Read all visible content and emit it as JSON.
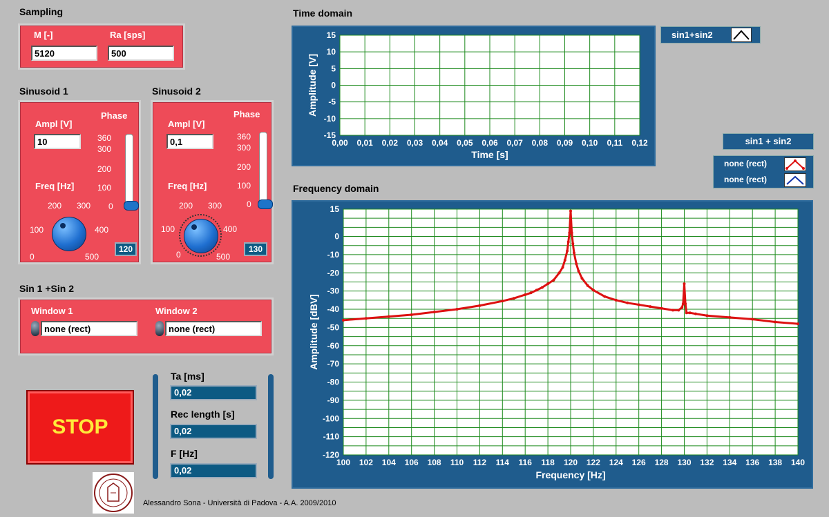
{
  "sampling": {
    "title": "Sampling",
    "m_label": "M  [-]",
    "m_value": "5120",
    "ra_label": "Ra   [sps]",
    "ra_value": "500"
  },
  "sinusoid1": {
    "title": "Sinusoid 1",
    "ampl_label": "Ampl [V]",
    "ampl_value": "10",
    "phase_label": "Phase",
    "phase_ticks": [
      "360",
      "300",
      "200",
      "100",
      "0"
    ],
    "freq_label": "Freq [Hz]",
    "knob_ticks": [
      "0",
      "100",
      "200",
      "300",
      "400",
      "500"
    ],
    "freq_value": "120"
  },
  "sinusoid2": {
    "title": "Sinusoid 2",
    "ampl_label": "Ampl [V]",
    "ampl_value": "0,1",
    "phase_label": "Phase",
    "phase_ticks": [
      "360",
      "300",
      "200",
      "100",
      "0"
    ],
    "freq_label": "Freq [Hz]",
    "knob_ticks": [
      "0",
      "100",
      "200",
      "300",
      "400",
      "500"
    ],
    "freq_value": "130"
  },
  "sum": {
    "title": "Sin 1 +Sin 2",
    "window1_label": "Window 1",
    "window1_value": "none (rect)",
    "window2_label": "Window 2",
    "window2_value": "none (rect)"
  },
  "stop_label": "STOP",
  "indicators": {
    "ta_label": "Ta   [ms]",
    "ta_value": "0,02",
    "rec_label": "Rec length  [s]",
    "rec_value": "0,02",
    "f_label": "F [Hz]",
    "f_value": "0,02"
  },
  "footer": "Alessandro Sona - Università di Padova - A.A. 2009/2010",
  "time_graph": {
    "title": "Time domain",
    "legend": "sin1+sin2"
  },
  "freq_graph": {
    "title": "Frequency domain",
    "legend_title": "sin1 + sin2",
    "legend_items": [
      "none (rect)",
      "none (rect)"
    ]
  },
  "colors": {
    "panel": "#ee4b58",
    "graph_frame": "#1f5c8d",
    "trace": "#dd1111",
    "grid": "#1c8a1c"
  },
  "chart_data": [
    {
      "type": "line",
      "title": "Time domain",
      "xlabel": "Time      [s]",
      "ylabel": "Amplitude     [V]",
      "xlim": [
        0,
        0.12
      ],
      "ylim": [
        -15,
        15
      ],
      "x_ticks": [
        "0,00",
        "0,01",
        "0,02",
        "0,03",
        "0,04",
        "0,05",
        "0,06",
        "0,07",
        "0,08",
        "0,09",
        "0,10",
        "0,11",
        "0,12"
      ],
      "y_ticks": [
        "15",
        "10",
        "5",
        "0",
        "-5",
        "-10",
        "-15"
      ],
      "grid": true,
      "series": []
    },
    {
      "type": "line",
      "title": "Frequency domain",
      "xlabel": "Frequency        [Hz]",
      "ylabel": "Amplitude     [dBV]",
      "xlim": [
        100,
        140
      ],
      "ylim": [
        -120,
        15
      ],
      "x_ticks": [
        "100",
        "102",
        "104",
        "106",
        "108",
        "110",
        "112",
        "114",
        "116",
        "118",
        "120",
        "122",
        "124",
        "126",
        "128",
        "130",
        "132",
        "134",
        "136",
        "138",
        "140"
      ],
      "y_ticks": [
        "15",
        "0",
        "-10",
        "-20",
        "-30",
        "-40",
        "-50",
        "-60",
        "-70",
        "-80",
        "-90",
        "-100",
        "-110",
        "-120"
      ],
      "grid": true,
      "series": [
        {
          "x": [
            100,
            102,
            104,
            106,
            108,
            110,
            112,
            114,
            115,
            116,
            116.5,
            117,
            117.5,
            118,
            118.5,
            119,
            119.3,
            119.5,
            119.7,
            119.8,
            119.9,
            120,
            120.1,
            120.2,
            120.3,
            120.5,
            120.7,
            121,
            121.5,
            122,
            123,
            124,
            125,
            126,
            127,
            128,
            129,
            129.5,
            129.8,
            129.9,
            130,
            130.1,
            130.2,
            130.5,
            131,
            132,
            134,
            136,
            138,
            140
          ],
          "y": [
            -46,
            -45,
            -44,
            -43,
            -41.5,
            -40,
            -38,
            -35.5,
            -34,
            -32,
            -31,
            -29.5,
            -28,
            -26,
            -24,
            -20,
            -17,
            -13,
            -8,
            -3,
            2,
            14,
            2,
            -4,
            -9,
            -15,
            -19,
            -23,
            -27,
            -29.5,
            -33,
            -35,
            -36.5,
            -37.5,
            -38.5,
            -39.5,
            -40.5,
            -40.5,
            -39,
            -37,
            -26,
            -37,
            -42,
            -42,
            -42.5,
            -43.5,
            -44.5,
            -45.5,
            -47,
            -48
          ]
        }
      ]
    }
  ]
}
